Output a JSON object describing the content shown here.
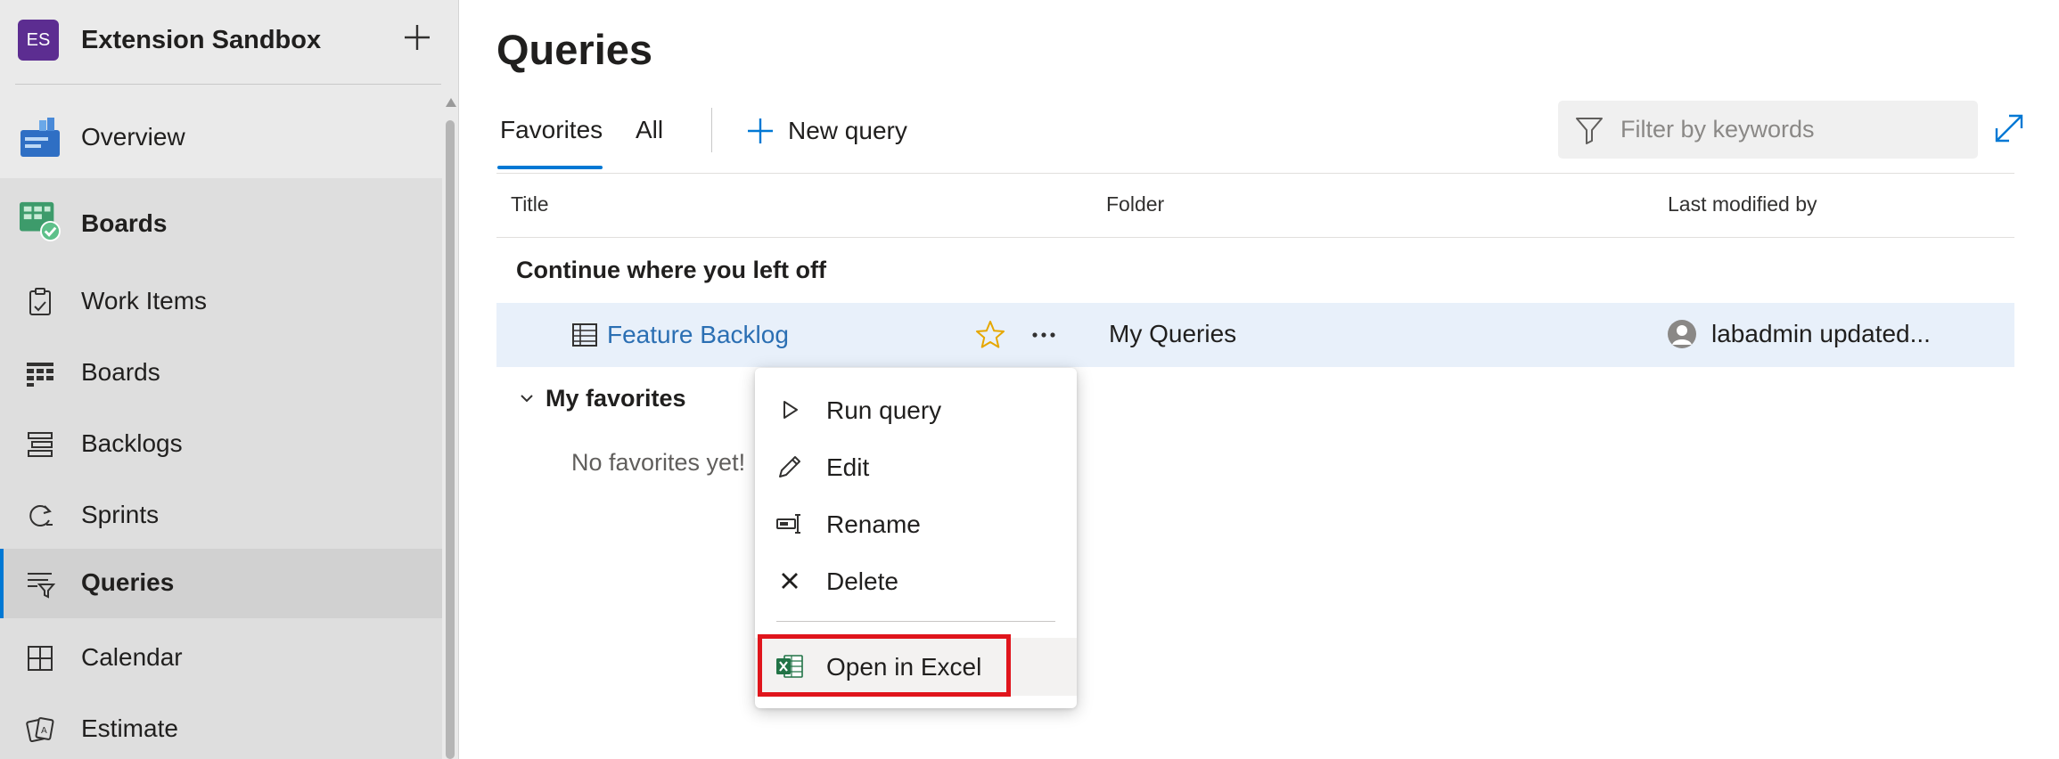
{
  "sidebar": {
    "org_initials": "ES",
    "org_name": "Extension Sandbox",
    "items": [
      {
        "label": "Overview",
        "icon": "overview-icon"
      },
      {
        "label": "Boards",
        "icon": "boards-hub-icon"
      },
      {
        "label": "Work Items",
        "icon": "work-items-icon"
      },
      {
        "label": "Boards",
        "icon": "board-icon"
      },
      {
        "label": "Backlogs",
        "icon": "backlogs-icon"
      },
      {
        "label": "Sprints",
        "icon": "sprints-icon"
      },
      {
        "label": "Queries",
        "icon": "queries-icon",
        "selected": true
      },
      {
        "label": "Calendar",
        "icon": "calendar-icon"
      },
      {
        "label": "Estimate",
        "icon": "estimate-icon"
      }
    ]
  },
  "main": {
    "title": "Queries",
    "tabs": [
      {
        "label": "Favorites",
        "active": true
      },
      {
        "label": "All",
        "active": false
      }
    ],
    "new_query_label": "New query",
    "filter_placeholder": "Filter by keywords",
    "columns": {
      "title": "Title",
      "folder": "Folder",
      "last_modified": "Last modified by"
    },
    "continue_section": "Continue where you left off",
    "row": {
      "title": "Feature Backlog",
      "folder": "My Queries",
      "last_modified": "labadmin updated..."
    },
    "favorites_section": "My favorites",
    "favorites_empty": "No favorites yet!"
  },
  "context_menu": {
    "items": [
      {
        "label": "Run query",
        "icon": "play-icon"
      },
      {
        "label": "Edit",
        "icon": "pencil-icon"
      },
      {
        "label": "Rename",
        "icon": "rename-icon"
      },
      {
        "label": "Delete",
        "icon": "delete-icon"
      },
      {
        "label": "Open in Excel",
        "icon": "excel-icon",
        "highlighted": true
      }
    ]
  },
  "colors": {
    "accent": "#0078d4",
    "org_avatar": "#5c2d91",
    "link": "#2b6fb3",
    "star": "#e6a700",
    "highlight_border": "#e0151c",
    "row_selected": "#e8f0fa"
  }
}
